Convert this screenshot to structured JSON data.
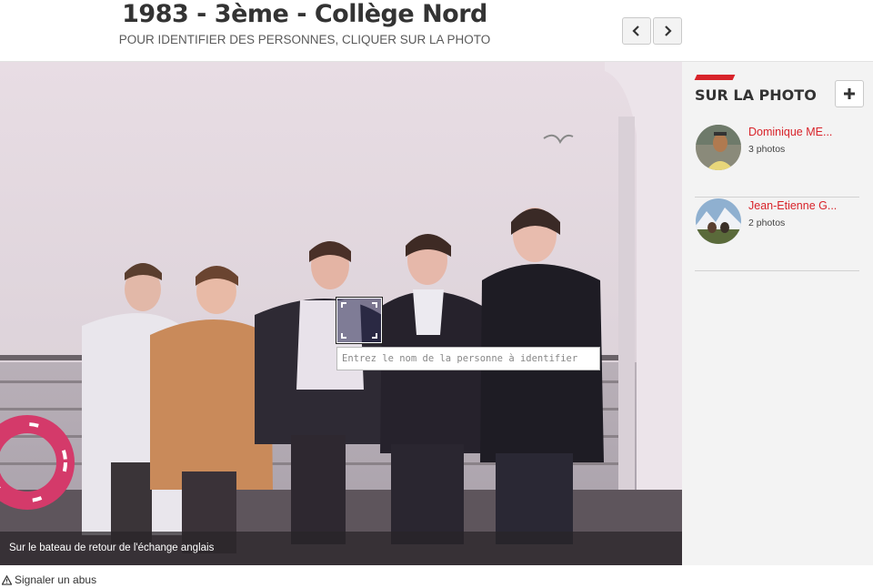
{
  "header": {
    "title": "1983 - 3ème - Collège Nord",
    "subtitle": "POUR IDENTIFIER DES PERSONNES, CLIQUER SUR LA PHOTO",
    "prev_icon": "chevron-left-icon",
    "next_icon": "chevron-right-icon"
  },
  "photo": {
    "caption": "Sur le bateau de retour de l'échange anglais",
    "tag_input_placeholder": "Entrez le nom de la personne à identifier"
  },
  "sidebar": {
    "title": "SUR LA PHOTO",
    "add_icon": "plus-icon",
    "accent_color": "#d8232a",
    "people": [
      {
        "name": "Dominique ME...",
        "photos": "3 photos"
      },
      {
        "name": "Jean-Etienne G...",
        "photos": "2 photos"
      }
    ]
  },
  "footer": {
    "report_link": "Signaler un abus",
    "report_icon": "warning-icon"
  }
}
